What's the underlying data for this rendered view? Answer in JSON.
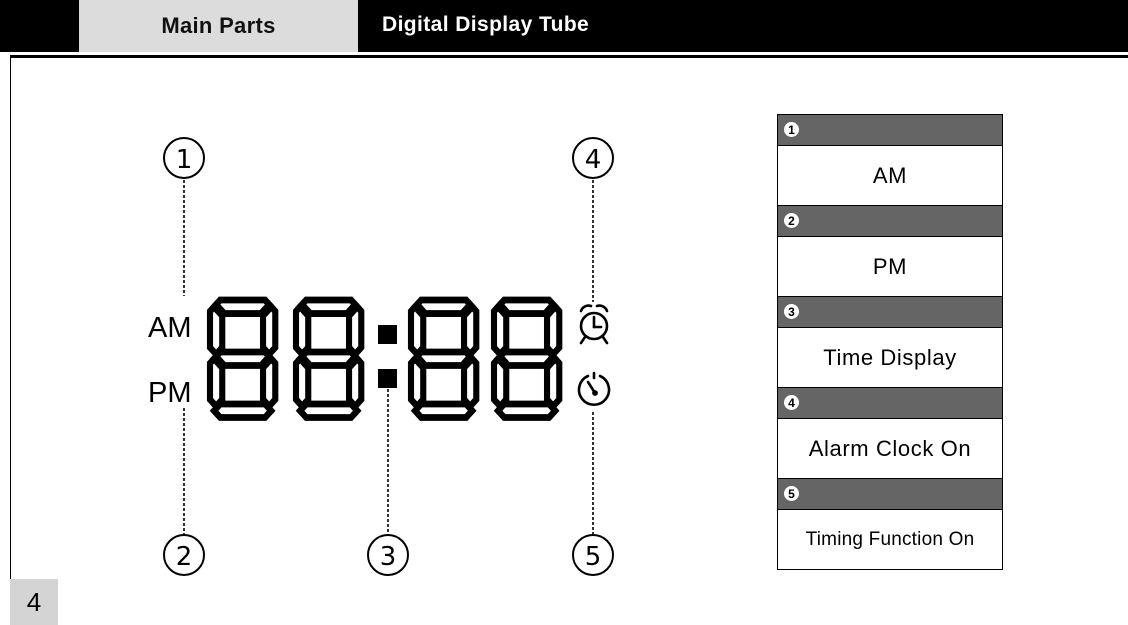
{
  "header": {
    "section_label": "Main Parts",
    "title": "Digital Display Tube"
  },
  "diagram": {
    "am_label": "AM",
    "pm_label": "PM",
    "digits": "88:88",
    "callouts": [
      "①",
      "②",
      "③",
      "④",
      "⑤"
    ],
    "icons": [
      "alarm-clock-icon",
      "timer-icon"
    ]
  },
  "legend": {
    "items": [
      {
        "number": "1",
        "label": "AM"
      },
      {
        "number": "2",
        "label": "PM"
      },
      {
        "number": "3",
        "label": "Time Display"
      },
      {
        "number": "4",
        "label": "Alarm Clock On"
      },
      {
        "number": "5",
        "label": "Timing Function On"
      }
    ]
  },
  "footer": {
    "page_number": "4"
  }
}
